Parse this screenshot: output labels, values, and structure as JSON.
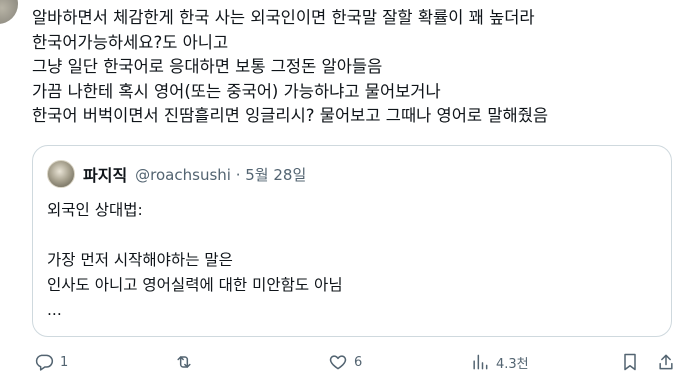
{
  "tweet": {
    "lines": [
      "알바하면서 체감한게 한국 사는 외국인이면 한국말 잘할 확률이 꽤 높더라",
      "한국어가능하세요?도 아니고",
      "그냥 일단 한국어로 응대하면 보통 그정돈 알아들음",
      "가끔 나한테 혹시 영어(또는 중국어) 가능하냐고 물어보거나",
      "한국어 버벅이면서 진땀흘리면 잉글리시? 물어보고 그때나 영어로 말해줬음"
    ]
  },
  "quoted": {
    "name": "파지직",
    "meta": "@roachsushi · 5월 28일",
    "lines": [
      "외국인 상대법:",
      "",
      "가장 먼저 시작해야하는 말은",
      "인사도 아니고 영어실력에 대한 미안함도 아님",
      "..."
    ]
  },
  "actions": {
    "reply_count": "1",
    "retweet_count": "",
    "like_count": "6",
    "views": "4.3천"
  },
  "colors": {
    "text": "#0f1419",
    "secondary": "#536471",
    "border": "#cfd9de"
  },
  "icons": [
    "reply-icon",
    "retweet-icon",
    "like-icon",
    "views-icon",
    "bookmark-icon",
    "share-icon"
  ]
}
